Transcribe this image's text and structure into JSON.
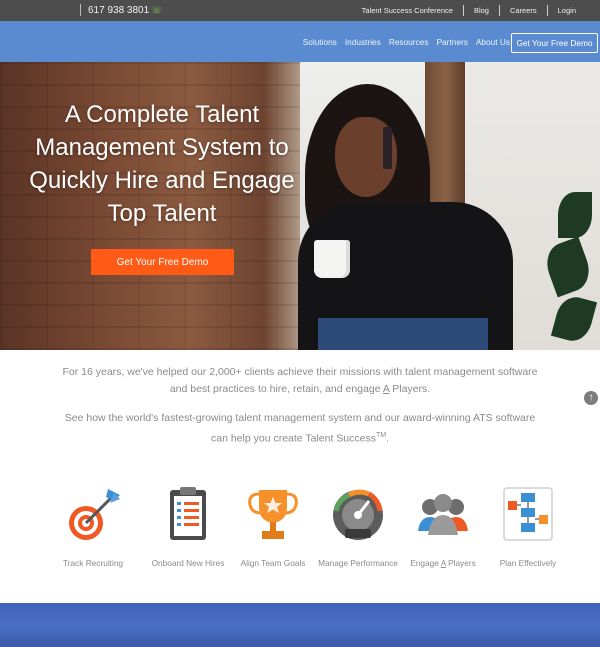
{
  "topbar": {
    "phone": "617 938 3801",
    "links": [
      "Talent Success Conference",
      "Blog",
      "Careers",
      "Login"
    ]
  },
  "nav": {
    "links": [
      "Solutions",
      "Industries",
      "Resources",
      "Partners",
      "About Us"
    ],
    "demo_button": "Get Your Free Demo"
  },
  "hero": {
    "title": "A Complete Talent Management System to Quickly Hire and Engage Top Talent",
    "cta": "Get Your Free Demo"
  },
  "intro": {
    "p1_before": "For 16 years, we've helped our 2,000+ clients achieve their missions with talent management software and best practices to hire, retain, and engage ",
    "p1_underline": "A",
    "p1_after": " Players.",
    "p2_main": "See how the world's fastest-growing talent management system and our award-winning ATS software can help you create Talent Success",
    "p2_sup": "TM",
    "p2_end": "."
  },
  "features": [
    {
      "label": "Track Recruiting",
      "icon": "target-icon"
    },
    {
      "label": "Onboard New Hires",
      "icon": "clipboard-icon"
    },
    {
      "label": "Align Team Goals",
      "icon": "trophy-icon"
    },
    {
      "label": "Manage Performance",
      "icon": "gauge-icon"
    },
    {
      "label_before": "Engage ",
      "label_u": "A",
      "label_after": " Players",
      "icon": "team-icon"
    },
    {
      "label": "Plan Effectively",
      "icon": "flowchart-icon"
    }
  ],
  "colors": {
    "topbar": "#4d4d4d",
    "nav": "#5a8bd0",
    "cta": "#ff5a16",
    "footer": "#4b6fc6"
  }
}
